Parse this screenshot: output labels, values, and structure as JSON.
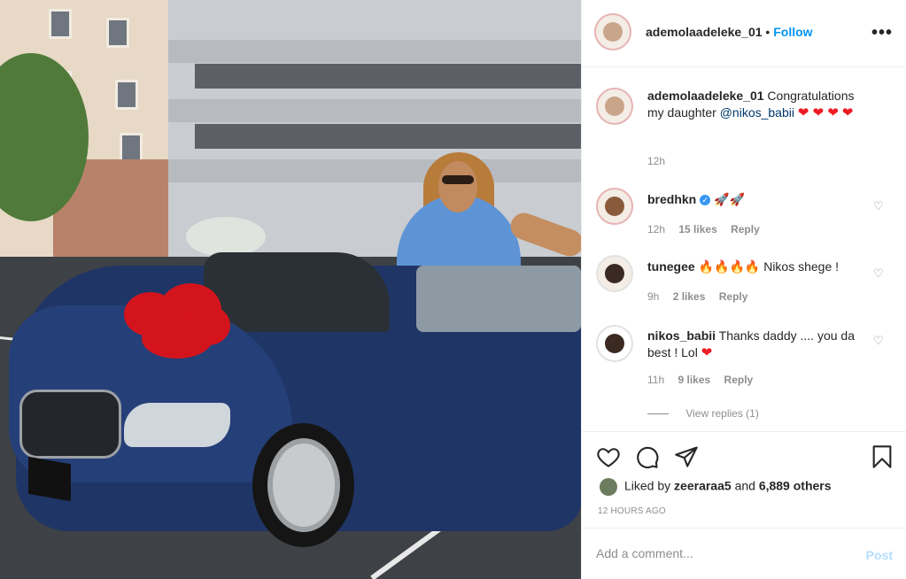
{
  "post": {
    "author": "ademolaadeleke_01",
    "follow_separator": "•",
    "follow_label": "Follow",
    "more_label": "•••"
  },
  "caption": {
    "user": "ademolaadeleke_01",
    "text_before": "Congratulations my daughter",
    "mention": "@nikos_babii",
    "hearts": "❤ ❤ ❤",
    "heart_last": "❤",
    "time": "12h"
  },
  "comments": [
    {
      "user": "bredhkn",
      "text": "🚀🚀",
      "time": "12h",
      "likes": "15 likes",
      "reply": "Reply"
    },
    {
      "user": "tunegee",
      "fires": "🔥🔥🔥🔥",
      "text": "Nikos shege !",
      "time": "9h",
      "likes": "2 likes",
      "reply": "Reply"
    },
    {
      "user": "nikos_babii",
      "text": "Thanks daddy .... you da best ! Lol",
      "heart": "❤",
      "time": "11h",
      "likes": "9 likes",
      "reply": "Reply"
    }
  ],
  "view_replies": "View replies (1)",
  "likes": {
    "prefix": "Liked by",
    "user": "zeeraraa5",
    "mid": "and",
    "count": "6,889 others"
  },
  "timestamp": "12 HOURS AGO",
  "add_comment": {
    "placeholder": "Add a comment...",
    "post_label": "Post"
  },
  "colors": {
    "link": "#0095f6",
    "mention": "#00376b",
    "heart": "#ed1c24",
    "muted": "#8e8e8e"
  }
}
